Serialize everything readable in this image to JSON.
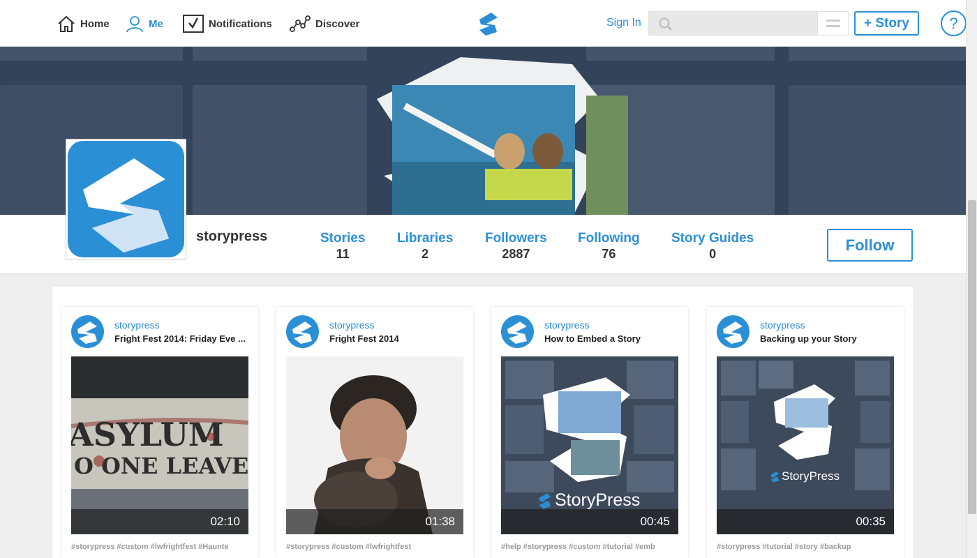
{
  "nav": {
    "home": "Home",
    "me": "Me",
    "notifications": "Notifications",
    "discover": "Discover",
    "sign_in": "Sign In",
    "search_placeholder": "",
    "story_button": "+ Story",
    "help": "?"
  },
  "profile": {
    "name": "storypress",
    "stats": [
      {
        "label": "Stories",
        "value": "11"
      },
      {
        "label": "Libraries",
        "value": "2"
      },
      {
        "label": "Followers",
        "value": "2887"
      },
      {
        "label": "Following",
        "value": "76"
      },
      {
        "label": "Story Guides",
        "value": "0"
      }
    ],
    "follow_button": "Follow"
  },
  "cards": [
    {
      "author": "storypress",
      "title": "Fright Fest 2014: Friday Eve ...",
      "duration": "02:10",
      "tags": "#storypress #custom #lwfrightfest #Haunte",
      "thumb": "asylum"
    },
    {
      "author": "storypress",
      "title": "Fright Fest 2014",
      "duration": "01:38",
      "tags": "#storypress #custom #lwfrightfest",
      "thumb": "portrait"
    },
    {
      "author": "storypress",
      "title": "How to Embed a Story",
      "duration": "00:45",
      "tags": "#help #storypress #custom #tutorial #emb",
      "thumb": "brand-large"
    },
    {
      "author": "storypress",
      "title": "Backing up your Story",
      "duration": "00:35",
      "tags": "#storypress #tutorial #story #backup",
      "thumb": "brand-small"
    }
  ],
  "brand_text": "StoryPress",
  "colors": {
    "accent": "#2b8fd6",
    "banner": "#3a4a60"
  }
}
